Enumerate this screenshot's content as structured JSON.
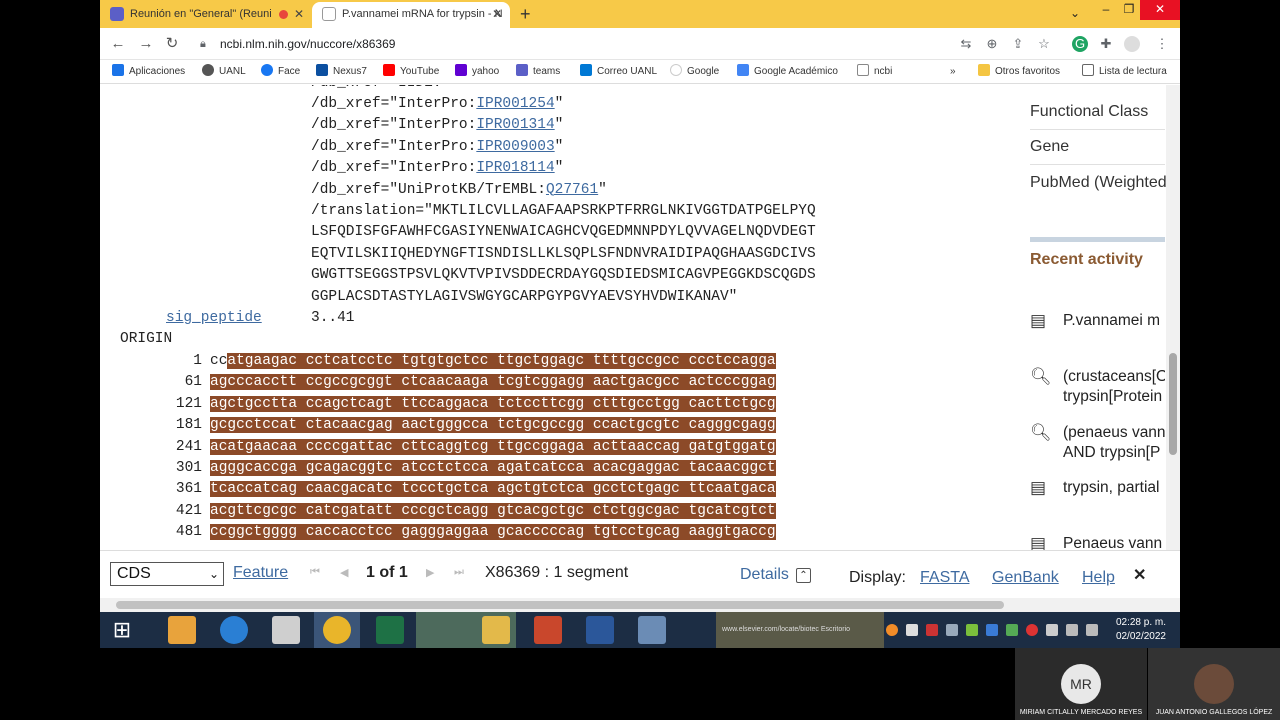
{
  "browser": {
    "tabs": [
      {
        "title": "Reunión en \"General\" (Reuni",
        "active": false
      },
      {
        "title": "P.vannamei mRNA for trypsin - N",
        "active": true
      }
    ],
    "new_tab": "+",
    "url": "ncbi.nlm.nih.gov/nuccore/x86369",
    "bookmarks": [
      "Aplicaciones",
      "UANL",
      "Face",
      "Nexus7",
      "YouTube",
      "yahoo",
      "teams",
      "Correo UANL",
      "Google",
      "Google Académico",
      "ncbi"
    ],
    "bookmarks_more": "»",
    "other_bookmarks": "Otros favoritos",
    "reading_list": "Lista de lectura"
  },
  "record": {
    "xref_partial": "/db_xref=\"IIDE:",
    "xrefs": [
      {
        "prefix": "/db_xref=\"InterPro:",
        "id": "IPR001254",
        "suffix": "\""
      },
      {
        "prefix": "/db_xref=\"InterPro:",
        "id": "IPR001314",
        "suffix": "\""
      },
      {
        "prefix": "/db_xref=\"InterPro:",
        "id": "IPR009003",
        "suffix": "\""
      },
      {
        "prefix": "/db_xref=\"InterPro:",
        "id": "IPR018114",
        "suffix": "\""
      },
      {
        "prefix": "/db_xref=\"UniProtKB/TrEMBL:",
        "id": "Q27761",
        "suffix": "\""
      }
    ],
    "translation_lines": [
      "/translation=\"MKTLILCVLLAGAFAAPSRKPTFRRGLNKIVGGTDATPGELPYQ",
      "LSFQDISFGFAWHFCGASIYNENWAICAGHCVQGEDMNNPDYLQVVAGELNQDVDEGT",
      "EQTVILSKIIQHEDYNGFTISNDISLLKLSQPLSFNDNVRAIDIPAQGHAASGDCIVS",
      "GWGTTSEGGSTPSVLQKVTVPIVSDDECRDAYGQSDIEDSMICAGVPEGGKDSCQGDS",
      "GGPLACSDTASTYLAGIVSWGYGCARPGYPGVYAEVSYHVDWIKANAV\""
    ],
    "sig_peptide_label": "sig_peptide",
    "sig_peptide_range": "3..41",
    "origin_label": "ORIGIN",
    "sequence": [
      {
        "num": "1",
        "pre": "cc",
        "seq": "atgaagac cctcatcctc tgtgtgctcc ttgctggagc ttttgccgcc ccctccagga"
      },
      {
        "num": "61",
        "pre": "",
        "seq": "agcccacctt ccgccgcggt ctcaacaaga tcgtcggagg aactgacgcc actcccggag"
      },
      {
        "num": "121",
        "pre": "",
        "seq": "agctgcctta ccagctcagt ttccaggaca tctccttcgg ctttgcctgg cacttctgcg"
      },
      {
        "num": "181",
        "pre": "",
        "seq": "gcgcctccat ctacaacgag aactgggcca tctgcgccgg ccactgcgtc cagggcgagg"
      },
      {
        "num": "241",
        "pre": "",
        "seq": "acatgaacaa ccccgattac cttcaggtcg ttgccggaga acttaaccag gatgtggatg"
      },
      {
        "num": "301",
        "pre": "",
        "seq": "agggcaccga gcagacggtc atcctctcca agatcatcca acacgaggac tacaacggct"
      },
      {
        "num": "361",
        "pre": "",
        "seq": "tcaccatcag caacgacatc tccctgctca agctgtctca gcctctgagc ttcaatgaca"
      },
      {
        "num": "421",
        "pre": "",
        "seq": "acgttcgcgc catcgatatt cccgctcagg gtcacgctgc ctctggcgac tgcatcgtct"
      },
      {
        "num": "481",
        "pre": "",
        "seq": "ccggctgggg caccacctcc gagggaggaa gcacccccag tgtcctgcag aaggtgaccg"
      }
    ]
  },
  "sidebar": {
    "links": [
      "Functional Class",
      "Gene",
      "PubMed (Weighted"
    ],
    "recent_activity_title": "Recent activity",
    "activities": [
      {
        "icon": "document-icon",
        "line1": "P.vannamei m",
        "line2": ""
      },
      {
        "icon": "search-icon",
        "line1": "(crustaceans[O",
        "line2": "trypsin[Protein"
      },
      {
        "icon": "search-icon",
        "line1": "(penaeus vann",
        "line2": "AND trypsin[P"
      },
      {
        "icon": "document-icon",
        "line1": "trypsin, partial",
        "line2": ""
      },
      {
        "icon": "document-icon",
        "line1": "Penaeus vann",
        "line2": ""
      }
    ]
  },
  "viewer_bar": {
    "select_value": "CDS",
    "feature_label": "Feature",
    "page_info": "1 of 1",
    "segment_info": "X86369 : 1 segment",
    "details_label": "Details",
    "display_label": "Display:",
    "formats": [
      "FASTA",
      "GenBank",
      "Help"
    ],
    "close": "✕"
  },
  "taskbar": {
    "time": "02:28 p. m.",
    "date": "02/02/2022",
    "escritorio": "Escritorio",
    "elsevier": "www.elsevier.com/locate/biotec"
  },
  "participants": [
    {
      "initials": "MR",
      "name": "MIRIAM CITLALLY MERCADO REYES"
    },
    {
      "initials": "",
      "name": "JUAN ANTONIO GALLEGOS LÓPEZ"
    }
  ],
  "colors": {
    "highlight": "#8c4a28",
    "link": "#3e6aa0",
    "recent_title": "#8a5a32",
    "tabbar": "#f7c948"
  }
}
